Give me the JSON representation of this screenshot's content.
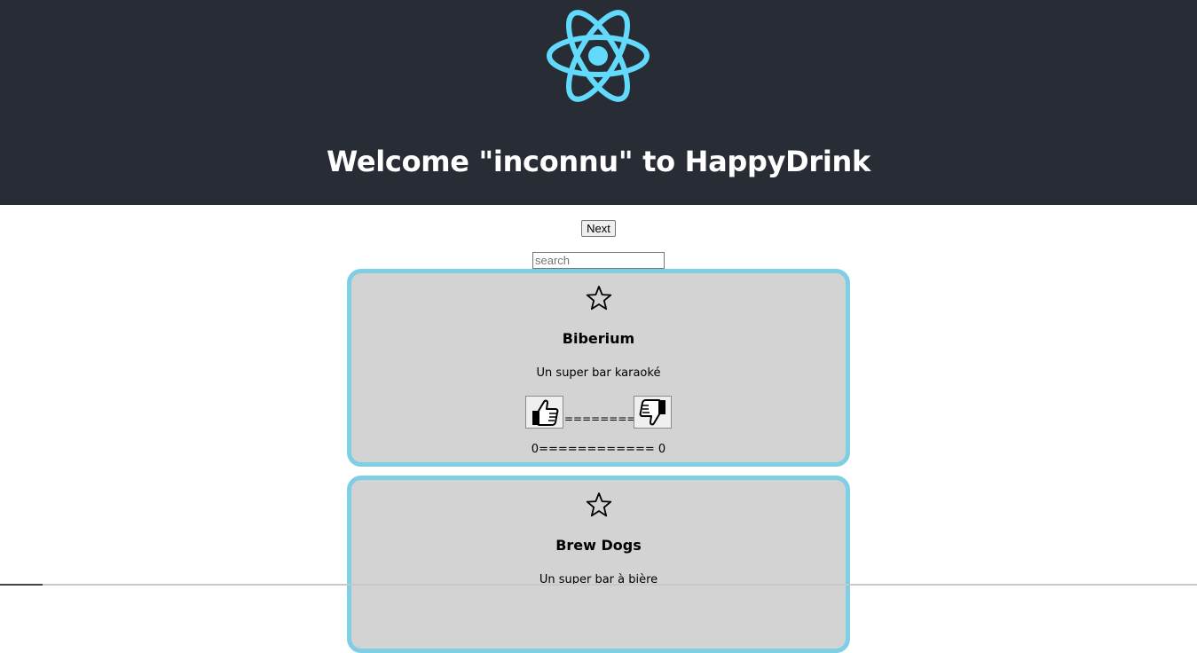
{
  "header": {
    "logo_icon": "react-atom-icon",
    "logo_color": "#61dafb",
    "background": "#282c34",
    "title": "Welcome \"inconnu\" to HappyDrink"
  },
  "controls": {
    "next_label": "Next",
    "search_placeholder": "search",
    "search_value": ""
  },
  "card_style": {
    "background": "#d3d3d3",
    "border_color": "#7ecfe4"
  },
  "bars": [
    {
      "favorite_icon": "star-outline-icon",
      "name": "Biberium",
      "description": "Un super bar karaoké",
      "like_icon": "thumbs-up-icon",
      "dislike_icon": "thumbs-down-icon",
      "separator": "========",
      "likes": "0",
      "score_separator": "============",
      "dislikes": "0"
    },
    {
      "favorite_icon": "star-outline-icon",
      "name": "Brew Dogs",
      "description": "Un super bar à bière"
    }
  ]
}
